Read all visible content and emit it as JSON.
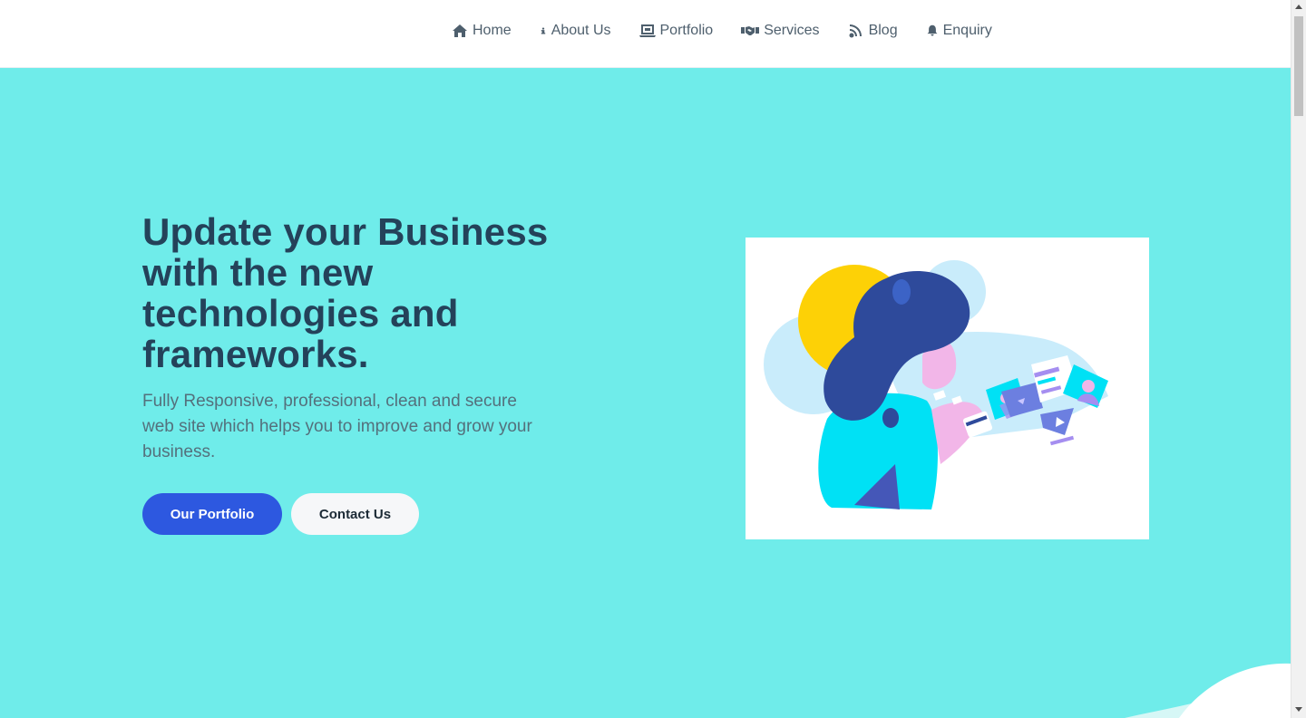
{
  "nav": {
    "items": [
      {
        "label": "Home",
        "icon": "home-icon"
      },
      {
        "label": "About Us",
        "icon": "info-icon"
      },
      {
        "label": "Portfolio",
        "icon": "laptop-icon"
      },
      {
        "label": "Services",
        "icon": "handshake-icon"
      },
      {
        "label": "Blog",
        "icon": "rss-icon"
      },
      {
        "label": "Enquiry",
        "icon": "bell-icon"
      }
    ]
  },
  "hero": {
    "title": "Update your Business with the new technologies and frameworks.",
    "subtitle": "Fully Responsive, professional, clean and secure web site which helps you to improve and grow your business.",
    "primary_button": "Our Portfolio",
    "secondary_button": "Contact Us"
  },
  "colors": {
    "hero_background": "#6fecea",
    "primary_button": "#2d58e0",
    "title_text": "#24425a",
    "nav_text": "#4e5f6d"
  }
}
